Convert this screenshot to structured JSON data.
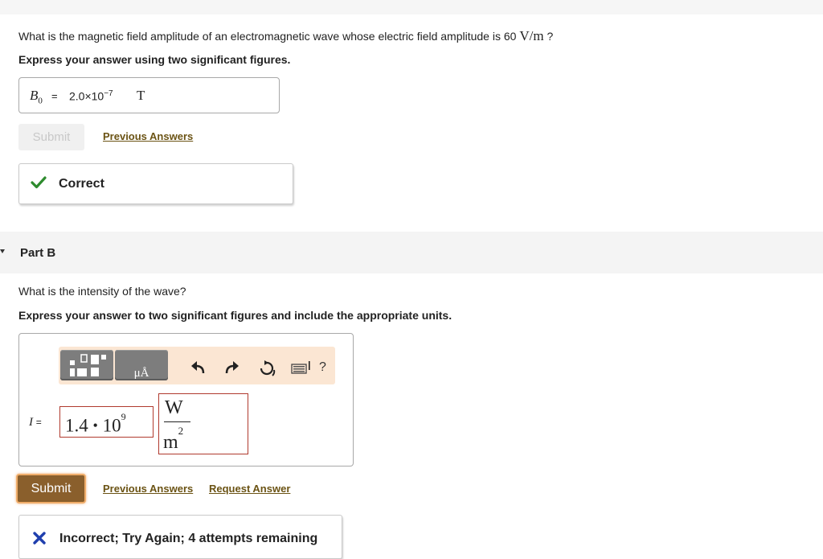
{
  "part_a": {
    "question_prefix": "What is the magnetic field amplitude of an electromagnetic wave whose electric field amplitude is 60 ",
    "question_unit": "V/m",
    "question_suffix": " ?",
    "instruction": "Express your answer using two significant figures.",
    "answer": {
      "variable": "B",
      "subscript": "0",
      "equals": "=",
      "mantissa": "2.0×10",
      "exponent": "−7",
      "unit": "T"
    },
    "submit_label": "Submit",
    "previous_answers_label": "Previous Answers",
    "feedback": {
      "text": "Correct",
      "status": "correct",
      "color": "#2e8b2e"
    }
  },
  "part_b": {
    "title": "Part B",
    "question": "What is the intensity of the wave?",
    "instruction": "Express your answer to two significant figures and include the appropriate units.",
    "toolbar": {
      "buttons": [
        "templates-icon",
        "units-icon"
      ],
      "units_glyph": "μÅ",
      "tools": [
        "undo-icon",
        "redo-icon",
        "reset-icon",
        "keyboard-icon"
      ],
      "help_label": "?",
      "background": "#fbe6d3"
    },
    "answer": {
      "variable": "I",
      "equals": "=",
      "mantissa": "1.4",
      "dot": "•",
      "base": "10",
      "exponent": "9",
      "unit_numerator": "W",
      "unit_denominator": "m",
      "unit_denominator_exp": "2",
      "box_color": "#b03a2e"
    },
    "submit_label": "Submit",
    "previous_answers_label": "Previous Answers",
    "request_answer_label": "Request Answer",
    "accent_color": "#8a5f2c",
    "feedback": {
      "text": "Incorrect; Try Again; 4 attempts remaining",
      "status": "incorrect",
      "color": "#1f3fae"
    }
  }
}
